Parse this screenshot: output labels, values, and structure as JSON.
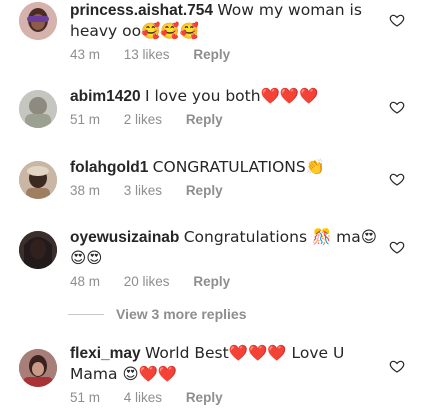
{
  "comments": [
    {
      "username": "princess.aishat.754",
      "text": "Wow my woman is heavy oo🥰🥰🥰",
      "time": "43 m",
      "likes": "13 likes",
      "reply": "Reply",
      "avatar_color": "#c9a6a3"
    },
    {
      "username": "abim1420",
      "text": "I love you both❤️❤️❤️",
      "time": "51 m",
      "likes": "2 likes",
      "reply": "Reply",
      "avatar_color": "#b9bab1"
    },
    {
      "username": "folahgold1",
      "text": "CONGRATULATIONS👏",
      "time": "38 m",
      "likes": "3 likes",
      "reply": "Reply",
      "avatar_color": "#b99a82"
    },
    {
      "username": "oyewusizainab",
      "text": "Congratulations 🎊 ma😍😍😍",
      "time": "48 m",
      "likes": "20 likes",
      "reply": "Reply",
      "avatar_color": "#2a2422"
    },
    {
      "username": "flexi_may",
      "text": "World Best❤️❤️❤️ Love U Mama 😍❤️❤️",
      "time": "51 m",
      "likes": "4 likes",
      "reply": "Reply",
      "avatar_color": "#7d5650"
    }
  ],
  "view_more": "View 3 more replies",
  "colors": {
    "text": "#262626",
    "meta": "#8e8e8e"
  },
  "icons": {
    "like": "heart-outline-icon"
  }
}
